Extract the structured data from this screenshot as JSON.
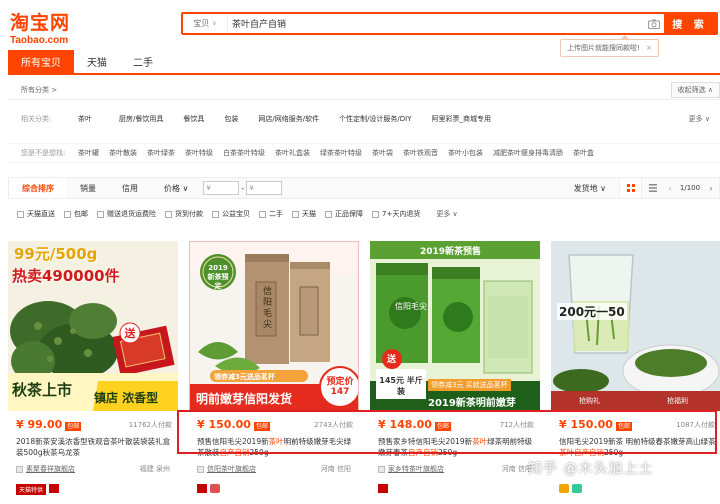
{
  "logo": {
    "cn": "淘宝网",
    "en": "Taobao.com"
  },
  "search": {
    "scope": "宝贝",
    "query": "茶叶自产自销",
    "button": "搜 索"
  },
  "tip": {
    "text": "上传图片就能搜同款啦!",
    "close": "×"
  },
  "tabs": [
    "所有宝贝",
    "天猫",
    "二手"
  ],
  "breadcrumb": "所有分类 >",
  "fold": "收起筛选 ∧",
  "related": {
    "label": "相关分类:",
    "items": [
      "茶叶",
      "厨房/餐饮用具",
      "餐饮具",
      "包装",
      "网店/网络服务/软件",
      "个性定制/设计服务/DIY",
      "阿里彩票_商城专用"
    ],
    "more": "更多 ∨"
  },
  "suggest": {
    "label": "您是不是想找:",
    "items": [
      "茶叶罐",
      "茶叶散装",
      "茶叶绿茶",
      "茶叶特级",
      "白茶茶叶特级",
      "茶叶礼盒装",
      "绿茶茶叶特级",
      "茶叶袋",
      "茶叶铁观音",
      "茶叶小包装",
      "减肥茶叶瘦身排毒清肠",
      "茶叶盒"
    ]
  },
  "sort": {
    "items": [
      "综合排序",
      "销量",
      "信用",
      "价格 ∨"
    ],
    "price_from": "¥",
    "price_to": "¥",
    "shipfrom": "发货地 ∨",
    "page": "1/100"
  },
  "filters": [
    "天猫直送",
    "包邮",
    "赠送退货运费险",
    "货到付款",
    "公益宝贝",
    "二手",
    "天猫",
    "正品保障",
    "7+天内退货"
  ],
  "filters_more": "更多 ∨",
  "products": [
    {
      "price": "¥ 99.00",
      "badge": "包邮",
      "sales": "11762人付款",
      "title_pre": "2018新茶安溪浓香型铁观音茶叶散装袋装礼盒装500g秋茶乌龙茶",
      "title_hl": "",
      "title_post": "",
      "shop": "素聚春祥旗舰店",
      "loc": "福建 泉州",
      "banner1": "99元/500g",
      "banner2": "热卖490000件",
      "banner3": "秋茶上市",
      "banner4": "镇店 浓香型",
      "gift": "送"
    },
    {
      "price": "¥ 150.00",
      "badge": "包邮",
      "sales": "2743人付款",
      "title_pre": "预售信阳毛尖2019新",
      "title_hl": "茶叶",
      "title_post": "明前特级嫩芽毛尖绿茶散装",
      "title_hl2": "自产自销",
      "title_post2": "250g",
      "shop": "信阳茶叶旗舰店",
      "loc": "河南 信阳",
      "banner1": "2019新茶预定",
      "banner2": "明前嫩芽信阳发货",
      "banner3": "领券减3元送品茗杯",
      "banner4": "预定价 147",
      "banner5": "信阳毛尖"
    },
    {
      "price": "¥ 148.00",
      "badge": "包邮",
      "sales": "712人付款",
      "title_pre": "预售家乡特信阳毛尖2019新",
      "title_hl": "茶叶",
      "title_post": "绿茶明前特级嫩芽春茶",
      "title_hl2": "自产自销",
      "title_post2": "250g",
      "shop": "家乡特茶叶旗舰店",
      "loc": "河南 信阳",
      "banner1": "2019新茶预售",
      "banner2": "2019新茶明前嫩芽",
      "banner3": "领券减3元 买就送品茗杯",
      "banner4": "145元 半斤装",
      "banner5": "信阳毛尖",
      "gift": "送"
    },
    {
      "price": "¥ 150.00",
      "badge": "包邮",
      "sales": "1087人付款",
      "title_pre": "信阳毛尖2019新茶 明前特级春茶嫩芽高山绿茶",
      "title_hl": "茶叶自产自销",
      "title_post": "250g",
      "shop": "",
      "loc": "",
      "banner1": "200元一50",
      "banner2": "抢购礼",
      "banner3": "抢福利"
    }
  ],
  "watermark": "知乎 @木头加上土"
}
